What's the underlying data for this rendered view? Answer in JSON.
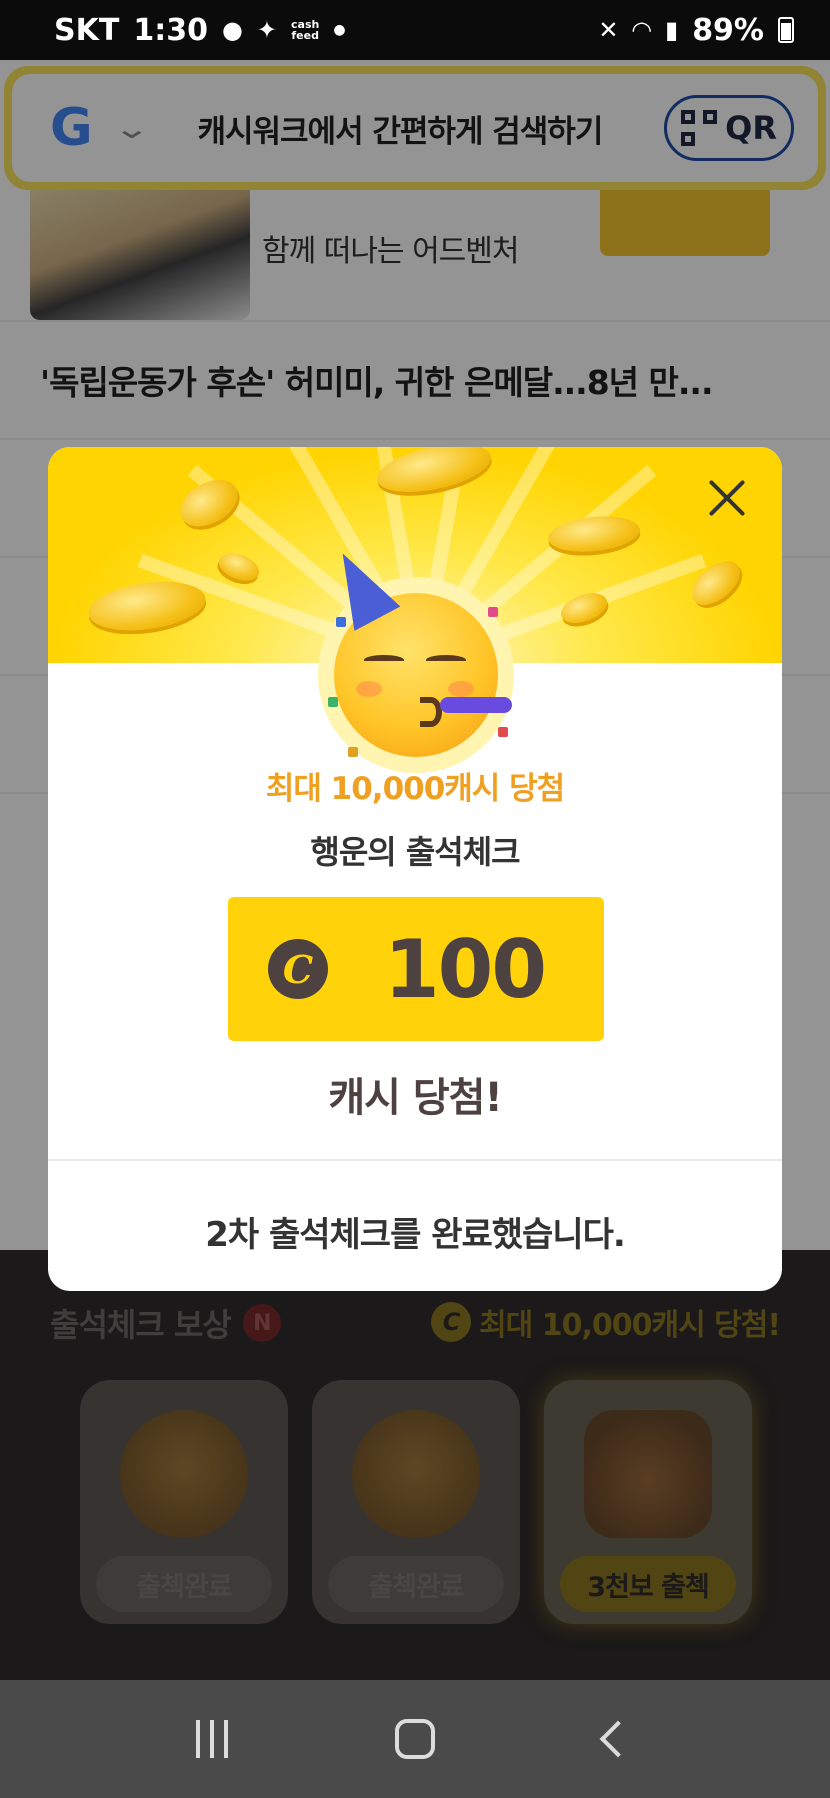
{
  "status_bar": {
    "carrier": "SKT",
    "time": "1:30",
    "notif_app_label": "cash\nfeed",
    "battery": "89%"
  },
  "search": {
    "engine_glyph": "G",
    "text": "캐시워크에서 간편하게 검색하기",
    "qr_label": "QR"
  },
  "banner": {
    "text": "함께 떠나는 어드벤처"
  },
  "news": [
    "'독립운동가 후손' 허미미, 귀한 은메달...8년 만..."
  ],
  "rewards_section": {
    "title": "출석체크 보상",
    "badge": "N",
    "max_cash": "최대 10,000캐시 당첨!",
    "coin_symbol": "C",
    "cards": [
      {
        "label": "출첵완료",
        "icon": "coin-stack-icon"
      },
      {
        "label": "출첵완료",
        "icon": "coin-stack-icon"
      },
      {
        "label": "3천보 출첵",
        "icon": "treasure-chest-icon"
      }
    ]
  },
  "modal": {
    "promo": "최대 10,000캐시 당첨",
    "title": "행운의 출석체크",
    "coin_symbol": "C",
    "amount": "100",
    "win_text": "캐시 당첨!",
    "complete_message": "2차 출석체크를 완료했습니다."
  },
  "colors": {
    "accent_yellow": "#ffd20a",
    "promo_orange": "#f0a020",
    "text_dark": "#4d4240"
  }
}
